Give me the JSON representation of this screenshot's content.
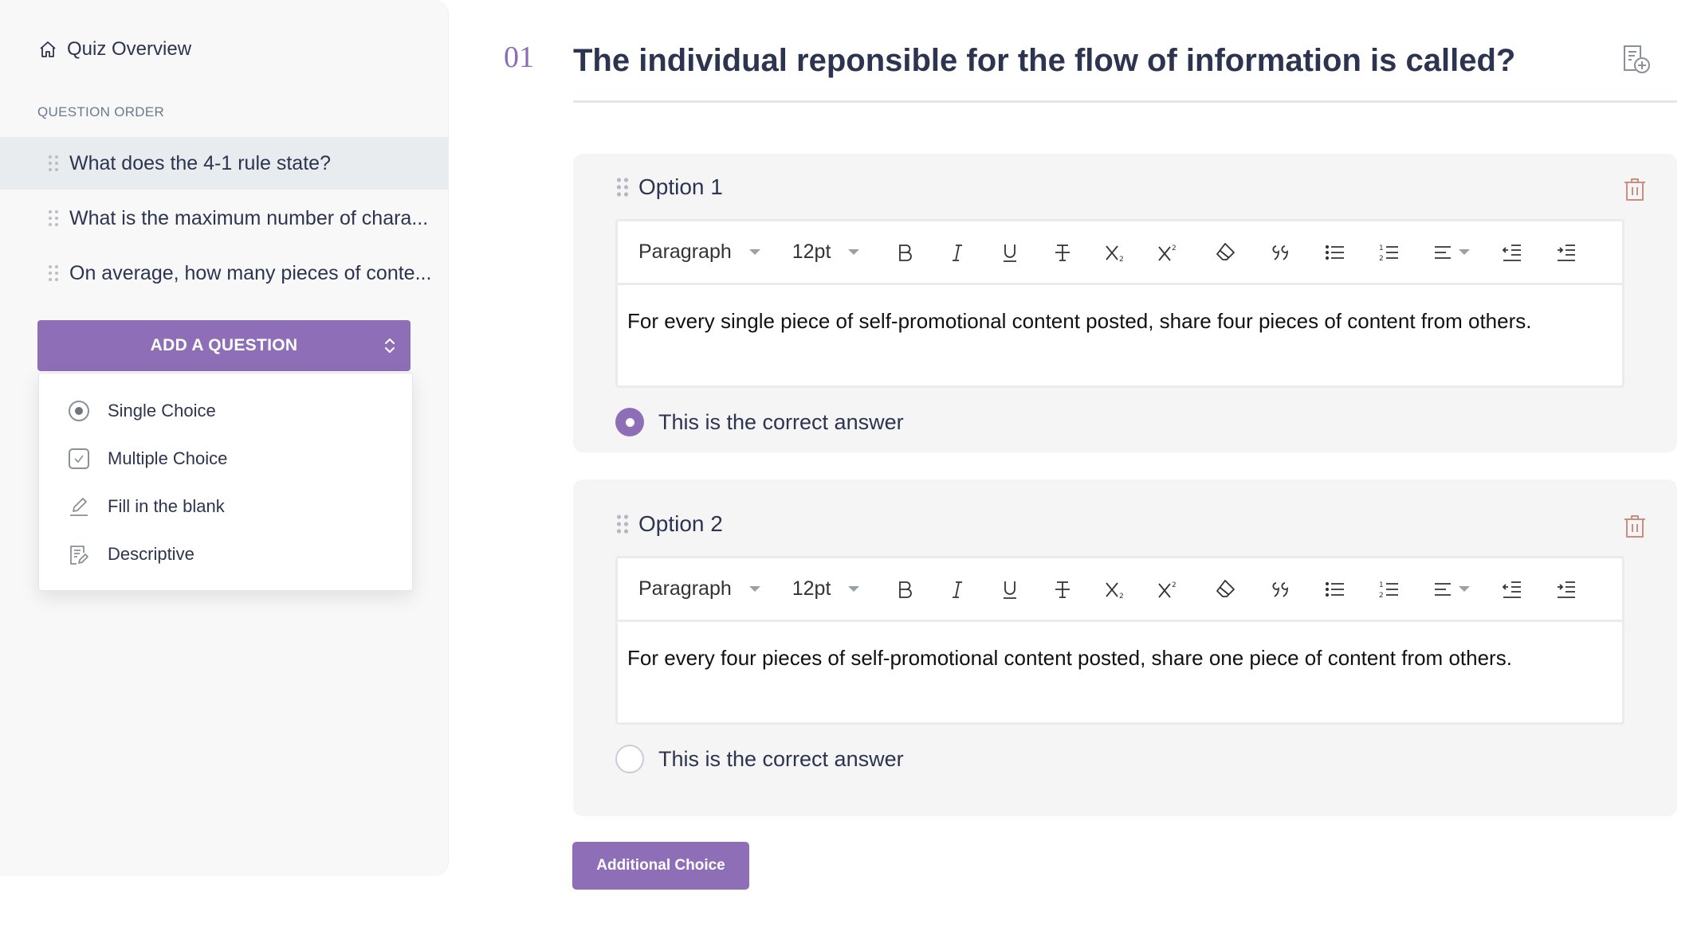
{
  "sidebar": {
    "overview_label": "Quiz Overview",
    "section_label": "QUESTION ORDER",
    "questions": [
      {
        "label": "What does the 4-1 rule state?",
        "selected": true
      },
      {
        "label": "What is the maximum number of chara...",
        "selected": false
      },
      {
        "label": "On average, how many pieces of conte...",
        "selected": false
      }
    ],
    "add_button_label": "ADD A QUESTION",
    "question_types": [
      {
        "label": "Single Choice",
        "icon": "radio-icon"
      },
      {
        "label": "Multiple Choice",
        "icon": "checkbox-icon"
      },
      {
        "label": "Fill in the blank",
        "icon": "pencil-icon"
      },
      {
        "label": "Descriptive",
        "icon": "document-edit-icon"
      }
    ]
  },
  "question": {
    "number": "01",
    "title": "The individual reponsible for the flow of information is called?"
  },
  "toolbar": {
    "block_format": "Paragraph",
    "font_size": "12pt"
  },
  "options": [
    {
      "label": "Option 1",
      "content": "For every single piece of self-promotional content posted, share four pieces of content from others.",
      "correct_label": "This is the correct answer",
      "is_correct": true
    },
    {
      "label": "Option 2",
      "content": "For every four pieces of self-promotional content posted, share one piece of content from others.",
      "correct_label": "This is the correct answer",
      "is_correct": false
    }
  ],
  "additional_choice_label": "Additional Choice",
  "colors": {
    "accent": "#8e6fb7",
    "text": "#2d3450",
    "trash": "#c98e7f",
    "card_bg": "#f5f5f6"
  }
}
